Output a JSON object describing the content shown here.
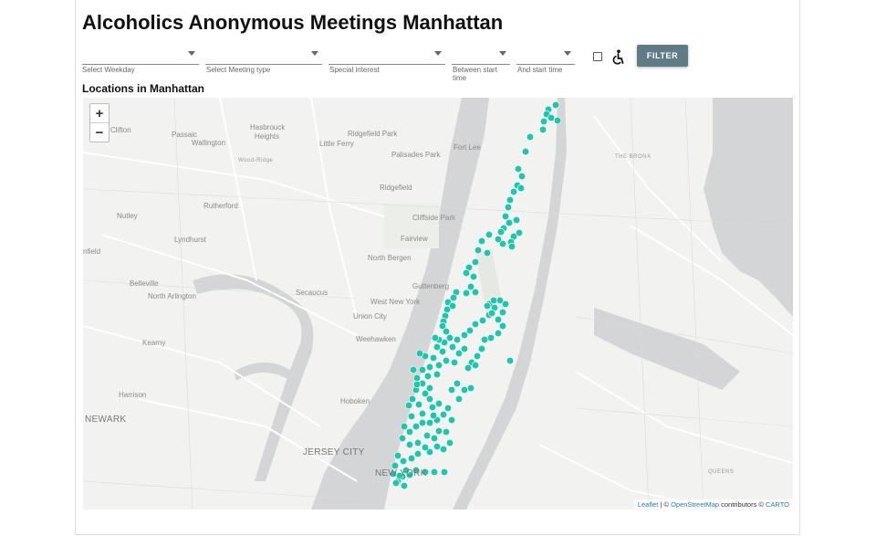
{
  "page": {
    "title": "Alcoholics Anonymous Meetings Manhattan"
  },
  "filters": {
    "weekday_label": "Select Weekday",
    "type_label": "Select Meeting type",
    "interest_label": "Special interest",
    "start_label_1": "Between start",
    "start_label_2": "time",
    "end_label": "And start time",
    "filter_button": "FILTER"
  },
  "map": {
    "heading": "Locations in Manhattan",
    "zoom_in": "+",
    "zoom_out": "−",
    "marker_color": "#23c4ad",
    "attribution": {
      "leaflet": "Leaflet",
      "sep1": " | © ",
      "osm": "OpenStreetMap",
      "mid": " contributors © ",
      "carto": "CARTO"
    },
    "place_labels": [
      "Clifton",
      "Passaic",
      "Wallington",
      "Hasbrouck",
      "Heights",
      "Ridgefield Park",
      "Little Ferry",
      "Fort Lee",
      "Palisades Park",
      "Wood-Ridge",
      "THE BRONX",
      "Rutherford",
      "Ridgefield",
      "Nutley",
      "Cliffside Park",
      "Lyndhurst",
      "Fairview",
      "nfield",
      "North Bergen",
      "Belleville",
      "Guttenberg",
      "North Arlington",
      "Secaucus",
      "West New York",
      "Union City",
      "Kearny",
      "Weehawken",
      "Harrison",
      "NEWARK",
      "Hoboken",
      "JERSEY CITY",
      "QUEENS",
      "NEW YORK"
    ]
  }
}
